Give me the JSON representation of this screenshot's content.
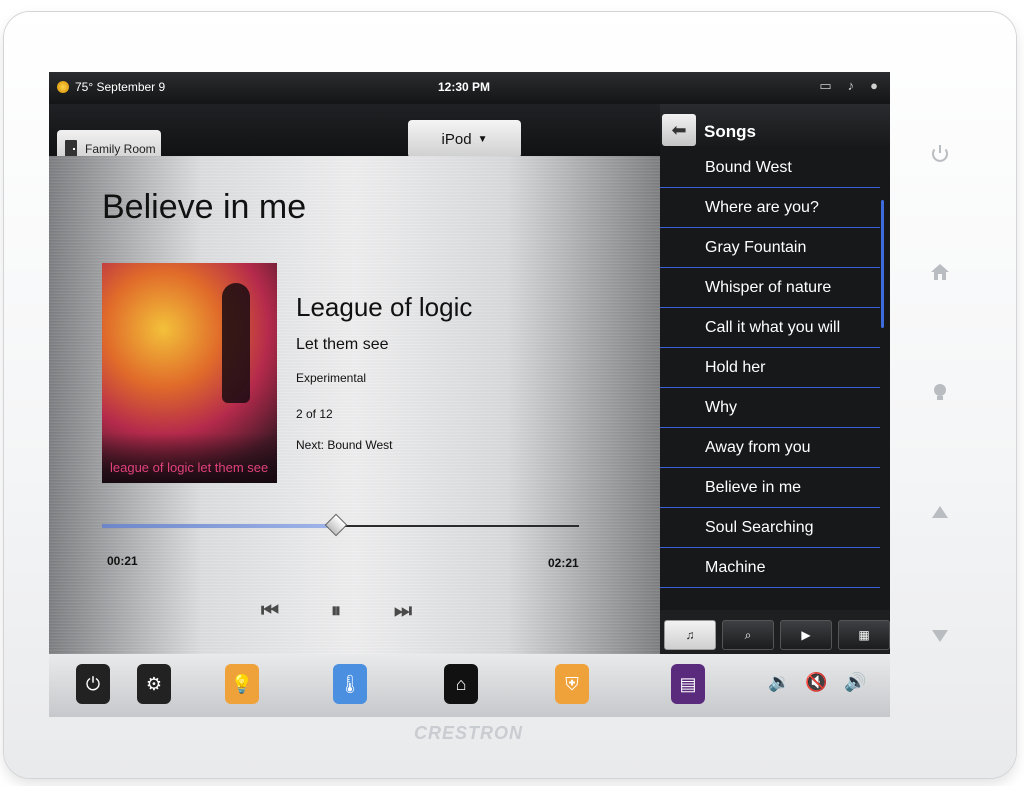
{
  "device": {
    "brand": "CRESTRON"
  },
  "status_bar": {
    "temperature_date": "75° September 9",
    "time": "12:30 PM"
  },
  "room": {
    "label": "Family Room"
  },
  "source": {
    "label": "iPod",
    "caret": "▼"
  },
  "now_playing": {
    "title": "Believe in me",
    "album_caption": "league of logic let them see",
    "artist": "League of logic",
    "album": "Let them see",
    "genre": "Experimental",
    "track": "2 of 12",
    "next": "Next: Bound West",
    "elapsed": "00:21",
    "total": "02:21",
    "progress_fraction": 0.49
  },
  "songs_panel": {
    "title": "Songs",
    "items": [
      "Bound West",
      "Where are you?",
      "Gray Fountain",
      "Whisper of nature",
      "Call it what you will",
      "Hold her",
      "Why",
      "Away from you",
      "Believe in me",
      "Soul Searching",
      "Machine"
    ]
  },
  "icons": {
    "door": "door-icon",
    "back": "back-arrow-icon",
    "prev": "skip-previous-icon",
    "pause": "pause-icon",
    "next": "skip-next-icon",
    "queue": "music-queue-icon",
    "search": "search-icon",
    "play": "play-icon",
    "grid": "grid-icon",
    "power": "power-icon",
    "settings": "gear-icon",
    "lights": "lightbulb-icon",
    "climate": "thermometer-icon",
    "home": "home-icon",
    "security": "shield-icon",
    "shades": "window-shades-icon"
  },
  "colors": {
    "accent": "#3b5fd8",
    "lights": "#f0a23a",
    "climate": "#4a8fe0",
    "security": "#f0a23a",
    "shades": "#5a2a7c"
  }
}
